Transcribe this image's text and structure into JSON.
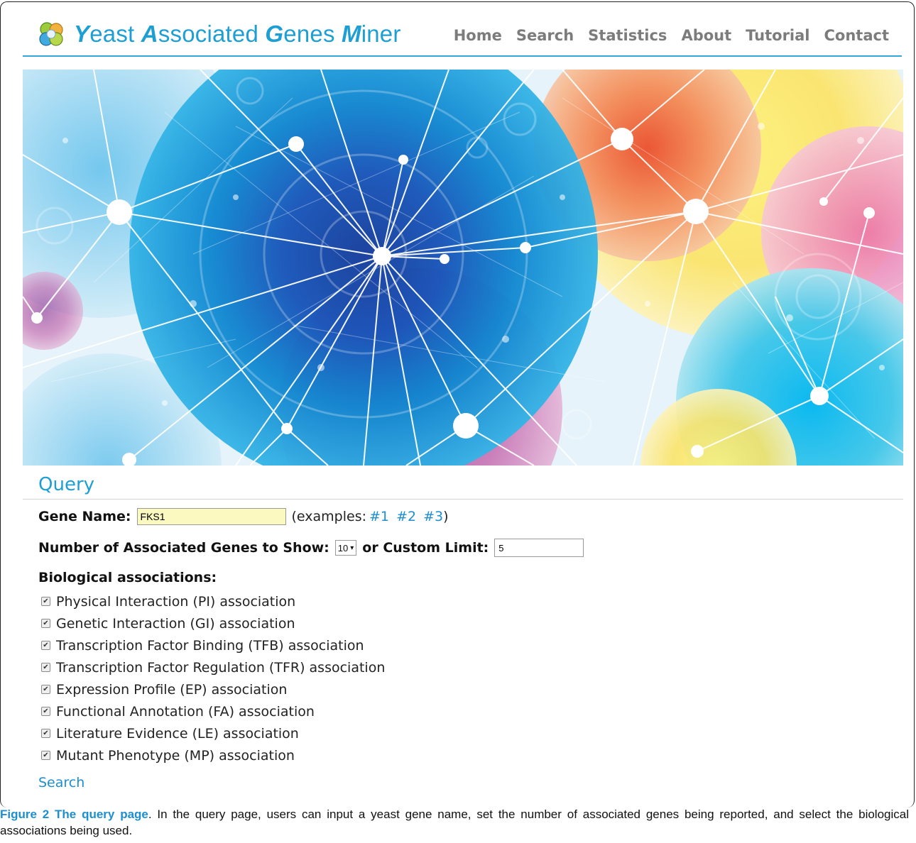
{
  "app": {
    "logo_name": "yeast-cluster-logo",
    "title_parts": [
      {
        "initial": "Y",
        "rest": "east "
      },
      {
        "initial": "A",
        "rest": "ssociated "
      },
      {
        "initial": "G",
        "rest": "enes "
      },
      {
        "initial": "M",
        "rest": "iner"
      }
    ]
  },
  "nav": {
    "items": [
      "Home",
      "Search",
      "Statistics",
      "About",
      "Tutorial",
      "Contact"
    ]
  },
  "query": {
    "title": "Query",
    "gene_label": "Gene Name:",
    "gene_value": "FKS1",
    "examples_prefix": "(examples:",
    "examples": [
      "#1",
      "#2",
      "#3"
    ],
    "examples_suffix": ")",
    "number_label": "Number of Associated Genes to Show:",
    "number_selected": "10",
    "custom_label": "or Custom Limit:",
    "custom_value": "5",
    "assoc_heading": "Biological associations:",
    "associations": [
      {
        "label": "Physical Interaction (PI) association",
        "checked": true
      },
      {
        "label": "Genetic Interaction (GI) association",
        "checked": true
      },
      {
        "label": "Transcription Factor Binding (TFB) association",
        "checked": true
      },
      {
        "label": "Transcription Factor Regulation (TFR) association",
        "checked": true
      },
      {
        "label": "Expression Profile (EP) association",
        "checked": true
      },
      {
        "label": "Functional Annotation (FA) association",
        "checked": true
      },
      {
        "label": "Literature Evidence (LE) association",
        "checked": true
      },
      {
        "label": "Mutant Phenotype (MP) association",
        "checked": true
      }
    ],
    "search_label": "Search"
  },
  "caption": {
    "bold": "Figure 2 The query page",
    "text": ". In the query page, users can input a yeast gene name, set the number of associated genes being reported, and select the biological associations being used."
  },
  "colors": {
    "accent": "#1d9fd4",
    "nav_text": "#7c7c7c",
    "gene_input_bg": "#fbf8c0"
  }
}
